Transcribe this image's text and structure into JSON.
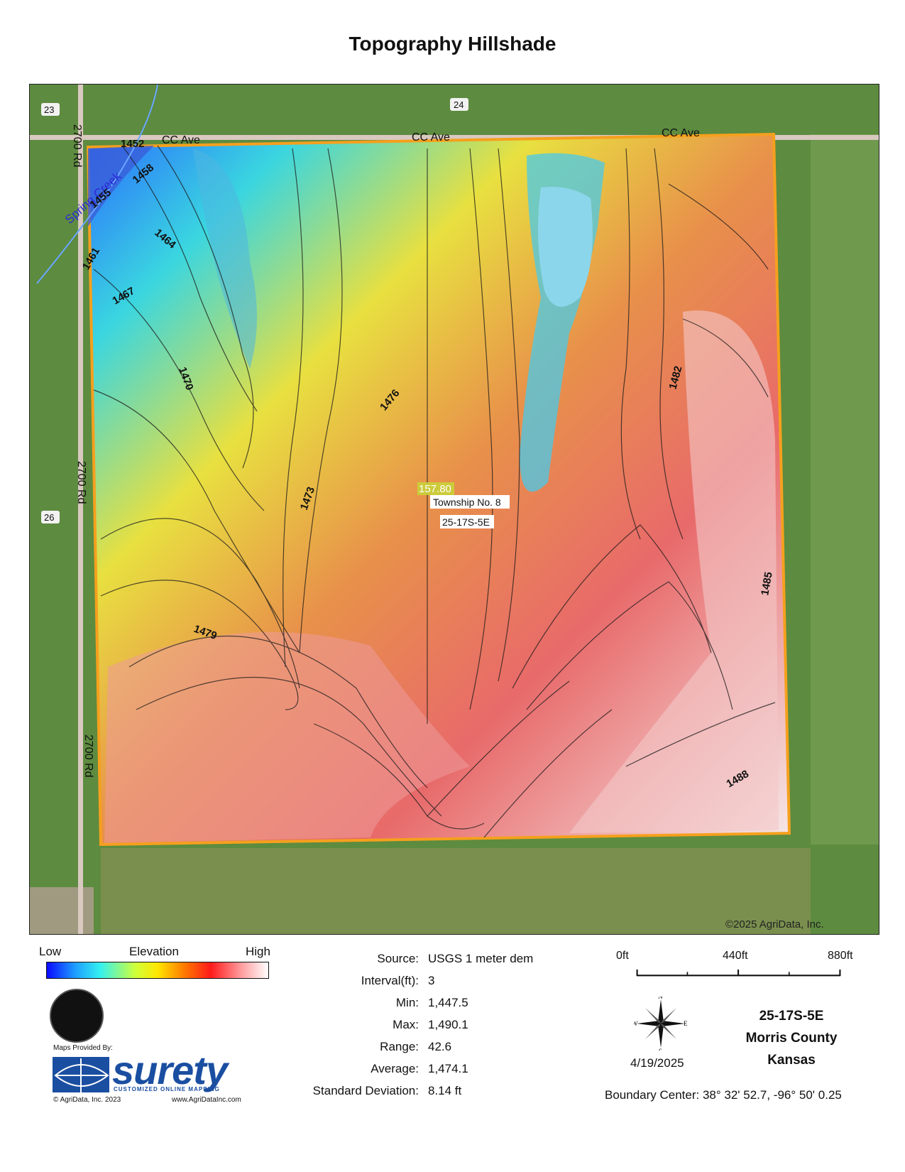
{
  "title": "Topography Hillshade",
  "map": {
    "road_labels": [
      {
        "text": "CC Ave"
      },
      {
        "text": "CC Ave"
      },
      {
        "text": "CC Ave"
      },
      {
        "text": "2700 Rd"
      },
      {
        "text": "2700 Rd"
      },
      {
        "text": "2700 Rd"
      }
    ],
    "section_numbers": [
      "23",
      "24",
      "26"
    ],
    "creek_label": "Spring Creek",
    "township_acres": "157.80",
    "township_name": "Township No. 8",
    "township_section": "25-17S-5E",
    "copyright": "©2025 AgriData, Inc.",
    "contour_labels": [
      "1452",
      "1455",
      "1458",
      "1461",
      "1464",
      "1467",
      "1470",
      "1473",
      "1476",
      "1479",
      "1482",
      "1485",
      "1488"
    ],
    "colors": {
      "boundary": "#f5a01e",
      "low": "#0a0aff",
      "high": "#ffffff"
    }
  },
  "legend": {
    "low": "Low",
    "elevation": "Elevation",
    "high": "High"
  },
  "stats": [
    {
      "label": "Source:",
      "value": "USGS 1 meter dem"
    },
    {
      "label": "Interval(ft):",
      "value": "3"
    },
    {
      "label": "Min:",
      "value": "1,447.5"
    },
    {
      "label": "Max:",
      "value": "1,490.1"
    },
    {
      "label": "Range:",
      "value": "42.6"
    },
    {
      "label": "Average:",
      "value": "1,474.1"
    },
    {
      "label": "Standard Deviation:",
      "value": "8.14 ft"
    }
  ],
  "scale": {
    "l0": "0ft",
    "l1": "440ft",
    "l2": "880ft"
  },
  "compass": {
    "n": "N",
    "s": "S",
    "e": "E",
    "w": "W"
  },
  "date": "4/19/2025",
  "location": {
    "section": "25-17S-5E",
    "county": "Morris County",
    "state": "Kansas"
  },
  "boundary_center": "Boundary Center: 38° 32' 52.7,  -96° 50' 0.25",
  "branding": {
    "provided_by": "Maps Provided By:",
    "brand": "surety",
    "tagline": "CUSTOMIZED ONLINE MAPPING",
    "copyright": "© AgriData, Inc. 2023",
    "website": "www.AgriDataInc.com"
  }
}
